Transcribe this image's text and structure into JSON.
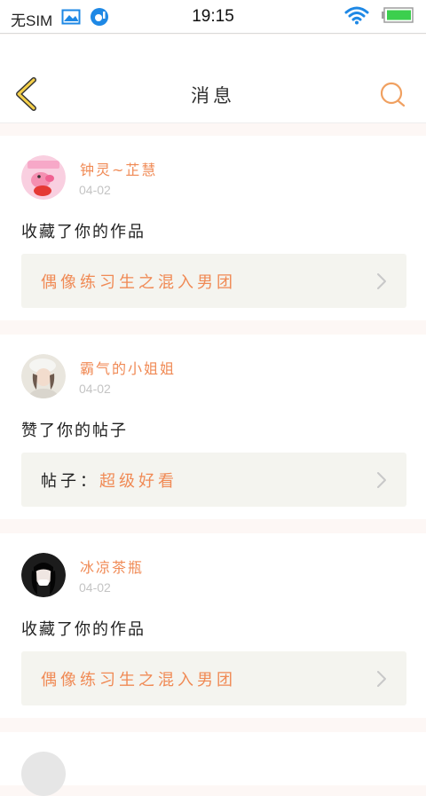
{
  "status_bar": {
    "sim": "无SIM",
    "time": "19:15"
  },
  "header": {
    "title": "消息",
    "accent_color": "#f0a060"
  },
  "feed": [
    {
      "username": "钟灵~芷慧",
      "date": "04-02",
      "action": "收藏了你的作品",
      "link_prefix": "",
      "link_title": "偶像练习生之混入男团",
      "avatar": "peppa-pig-avatar"
    },
    {
      "username": "霸气的小姐姐",
      "date": "04-02",
      "action": "赞了你的帖子",
      "link_prefix": "帖子：",
      "link_title": "超级好看",
      "avatar": "girl-photo-avatar"
    },
    {
      "username": "冰凉茶瓶",
      "date": "04-02",
      "action": "收藏了你的作品",
      "link_prefix": "",
      "link_title": "偶像练习生之混入男团",
      "avatar": "dark-hair-avatar"
    }
  ],
  "colors": {
    "username": "#f08a55",
    "date": "#c4c4c4",
    "link_box_bg": "#f4f4ef",
    "page_bg": "#fdf7f5"
  }
}
